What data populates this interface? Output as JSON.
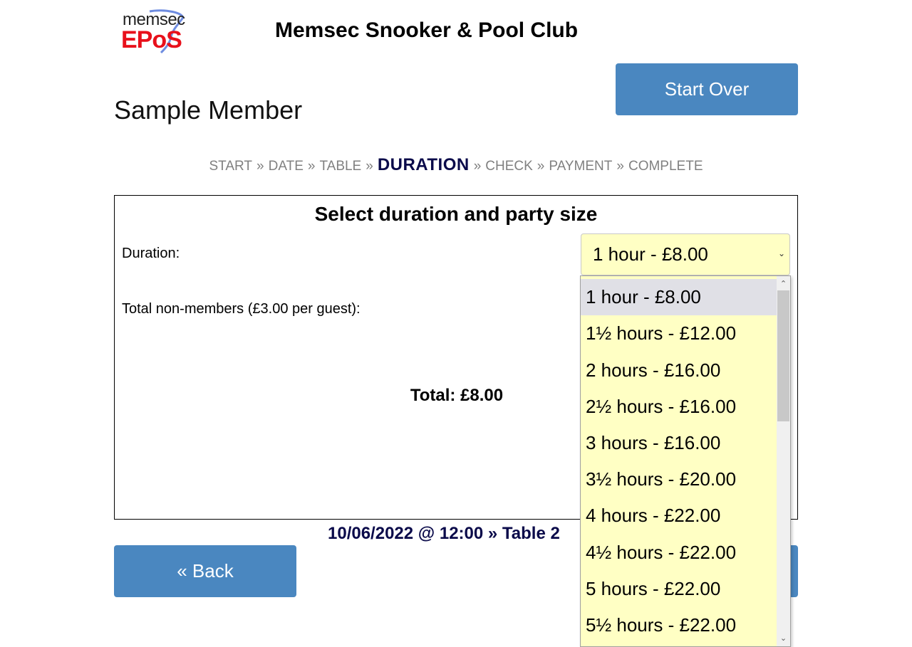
{
  "header": {
    "logo_top": "memsec",
    "logo_bottom": "EPoS",
    "club_name": "Memsec Snooker & Pool Club",
    "start_over_label": "Start Over",
    "member_name": "Sample Member"
  },
  "steps": {
    "items": [
      "START",
      "DATE",
      "TABLE",
      "DURATION",
      "CHECK",
      "PAYMENT",
      "COMPLETE"
    ],
    "separator": "»",
    "current": "DURATION"
  },
  "panel": {
    "title": "Select duration and party size",
    "duration_label": "Duration:",
    "guests_label": "Total non-members (£3.00 per guest):",
    "total_label": "Total: £8.00"
  },
  "duration_select": {
    "selected": "1 hour - £8.00",
    "options": [
      "1 hour - £8.00",
      "1½ hours - £12.00",
      "2 hours - £16.00",
      "2½ hours - £16.00",
      "3 hours - £16.00",
      "3½ hours - £20.00",
      "4 hours - £22.00",
      "4½ hours - £22.00",
      "5 hours - £22.00",
      "5½ hours - £22.00"
    ]
  },
  "summary": "10/06/2022 @ 12:00 » Table 2",
  "nav": {
    "back_label": "« Back"
  },
  "colors": {
    "button_blue": "#4a87c0",
    "select_bg": "#ffffc4",
    "current_step": "#0a0a4a",
    "step_grey": "#808080",
    "logo_red": "#e8101b"
  }
}
